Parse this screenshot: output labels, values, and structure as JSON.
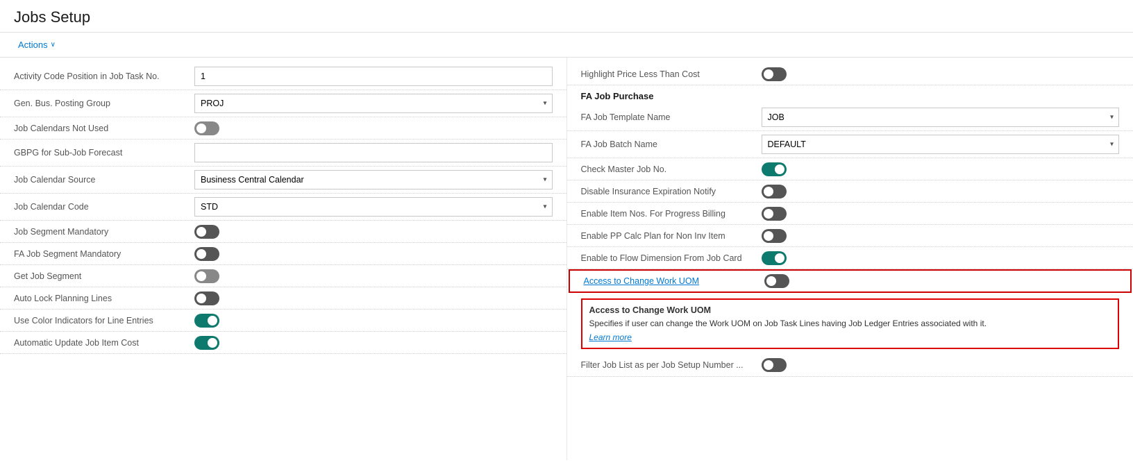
{
  "page": {
    "title": "Jobs Setup"
  },
  "toolbar": {
    "actions_label": "Actions",
    "chevron": "∨"
  },
  "left_panel": {
    "rows": [
      {
        "label": "Activity Code Position in Job Task No.",
        "type": "text",
        "value": "1"
      },
      {
        "label": "Gen. Bus. Posting Group",
        "type": "select",
        "value": "PROJ"
      },
      {
        "label": "Job Calendars Not Used",
        "type": "toggle",
        "state": "off"
      },
      {
        "label": "GBPG for Sub-Job Forecast",
        "type": "text",
        "value": ""
      },
      {
        "label": "Job Calendar Source",
        "type": "select",
        "value": "Business Central Calendar"
      },
      {
        "label": "Job Calendar Code",
        "type": "select",
        "value": "STD"
      },
      {
        "label": "Job Segment Mandatory",
        "type": "toggle",
        "state": "off-dark"
      },
      {
        "label": "FA Job Segment Mandatory",
        "type": "toggle",
        "state": "off-dark"
      },
      {
        "label": "Get Job Segment",
        "type": "toggle",
        "state": "off"
      },
      {
        "label": "Auto Lock Planning Lines",
        "type": "toggle",
        "state": "off-dark"
      },
      {
        "label": "Use Color Indicators for Line Entries",
        "type": "toggle",
        "state": "on"
      },
      {
        "label": "Automatic Update Job Item Cost",
        "type": "toggle",
        "state": "on"
      }
    ]
  },
  "right_panel": {
    "section_label": "FA Job Purchase",
    "rows_top": [
      {
        "label": "Highlight Price Less Than Cost",
        "type": "toggle",
        "state": "off-dark"
      }
    ],
    "rows": [
      {
        "label": "FA Job Template Name",
        "type": "select",
        "value": "JOB"
      },
      {
        "label": "FA Job Batch Name",
        "type": "select",
        "value": "DEFAULT"
      },
      {
        "label": "Check Master Job No.",
        "type": "toggle",
        "state": "on"
      },
      {
        "label": "Disable Insurance Expiration Notify",
        "type": "toggle",
        "state": "off-dark"
      },
      {
        "label": "Enable Item Nos. For Progress Billing",
        "type": "toggle",
        "state": "off-dark"
      },
      {
        "label": "Enable PP Calc Plan for Non Inv Item",
        "type": "toggle",
        "state": "off-dark"
      },
      {
        "label": "Enable to Flow Dimension From Job Card",
        "type": "toggle",
        "state": "on"
      },
      {
        "label": "Access to Change Work UOM",
        "type": "toggle",
        "state": "off-dark",
        "highlighted": true,
        "link": true
      }
    ],
    "tooltip": {
      "title": "Access to Change Work UOM",
      "text": "Specifies if user can change the Work UOM on Job Task Lines having Job Ledger Entries associated with it.",
      "link_label": "Learn more"
    },
    "rows_bottom": [
      {
        "label": "Filter Job List as per Job Setup Number ...",
        "type": "toggle",
        "state": "off-dark"
      }
    ]
  }
}
